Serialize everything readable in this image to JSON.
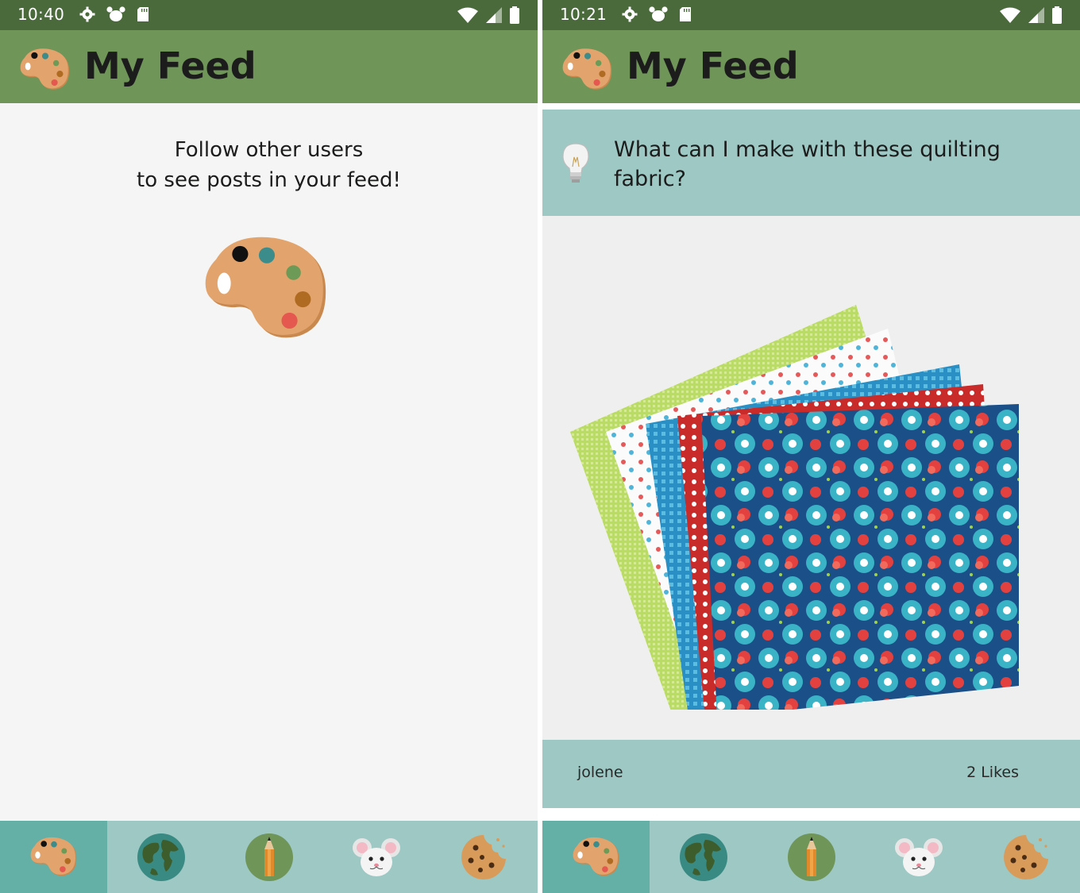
{
  "left_screen": {
    "status_bar": {
      "time": "10:40"
    },
    "app_bar": {
      "title": "My Feed"
    },
    "empty_state": {
      "line1": "Follow other users",
      "line2": "to see posts in your feed!"
    }
  },
  "right_screen": {
    "status_bar": {
      "time": "10:21"
    },
    "app_bar": {
      "title": "My Feed"
    },
    "post": {
      "title": "What can I make with these quilting fabric?",
      "author": "jolene",
      "likes": "2 Likes"
    }
  },
  "bottom_nav": {
    "items": [
      {
        "icon": "palette-icon",
        "active": true
      },
      {
        "icon": "globe-icon",
        "active": false
      },
      {
        "icon": "pencil-icon",
        "active": false
      },
      {
        "icon": "mouse-icon",
        "active": false
      },
      {
        "icon": "cookie-icon",
        "active": false
      }
    ]
  },
  "colors": {
    "status_bar": "#4a6a3c",
    "app_bar": "#6f9559",
    "card": "#9dc8c4",
    "nav_active": "#64afa6",
    "background": "#f4f5f4"
  }
}
